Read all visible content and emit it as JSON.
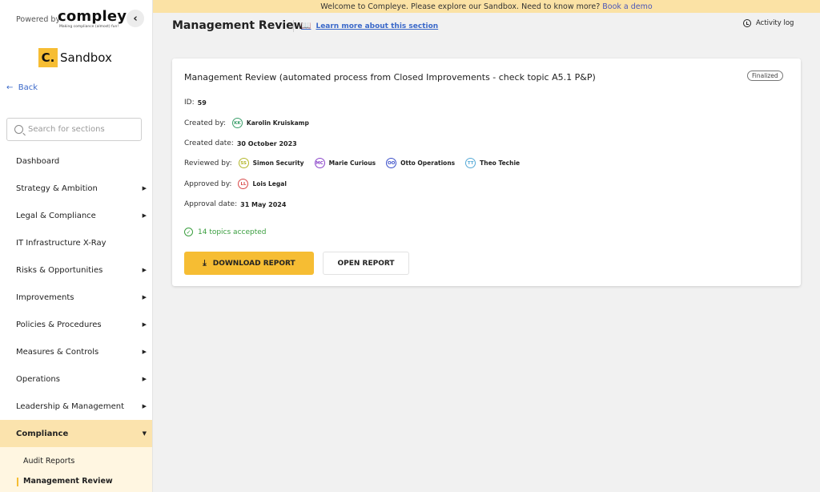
{
  "brand": {
    "powered_by": "Powered by",
    "logo": "compleye",
    "tagline": "Making compliance (almost) fun!",
    "org_initial": "C.",
    "org_name": "Sandbox",
    "collapse_icon": "chevron-left-icon"
  },
  "sidebar": {
    "back_label": "Back",
    "search_placeholder": "Search for sections",
    "items": [
      {
        "label": "Dashboard",
        "has_children": false
      },
      {
        "label": "Strategy & Ambition",
        "has_children": true
      },
      {
        "label": "Legal & Compliance",
        "has_children": true
      },
      {
        "label": "IT Infrastructure X-Ray",
        "has_children": false
      },
      {
        "label": "Risks & Opportunities",
        "has_children": true
      },
      {
        "label": "Improvements",
        "has_children": true
      },
      {
        "label": "Policies & Procedures",
        "has_children": true
      },
      {
        "label": "Measures & Controls",
        "has_children": true
      },
      {
        "label": "Operations",
        "has_children": true
      },
      {
        "label": "Leadership & Management",
        "has_children": true
      },
      {
        "label": "Compliance",
        "has_children": true,
        "expanded": true
      }
    ],
    "subitems": [
      {
        "label": "Audit Reports"
      },
      {
        "label": "Management Review",
        "current": true
      }
    ]
  },
  "banner": {
    "text": "Welcome to Compleye. Please explore our Sandbox. Need to know more?",
    "link": "Book a demo"
  },
  "header": {
    "title": "Management Review",
    "learn_more": "Learn more about this section",
    "activity_log": "Activity log"
  },
  "review": {
    "title": "Management Review (automated process from Closed Improvements - check topic A5.1 P&P)",
    "status": "Finalized",
    "id_label": "ID:",
    "id_value": "59",
    "created_by_label": "Created by:",
    "created_by": {
      "initials": "KK",
      "name": "Karolin Kruiskamp",
      "color": "#3a9e6a"
    },
    "created_date_label": "Created date:",
    "created_date": "30 October 2023",
    "reviewed_by_label": "Reviewed by:",
    "reviewers": [
      {
        "initials": "SS",
        "name": "Simon Security",
        "color": "#b3b62a"
      },
      {
        "initials": "MC",
        "name": "Marie Curious",
        "color": "#8a43c9"
      },
      {
        "initials": "OO",
        "name": "Otto Operations",
        "color": "#3b4fc9"
      },
      {
        "initials": "TT",
        "name": "Theo Techie",
        "color": "#55a9d6"
      }
    ],
    "approved_by_label": "Approved by:",
    "approver": {
      "initials": "LL",
      "name": "Lois Legal",
      "color": "#d94a4a"
    },
    "approval_date_label": "Approval date:",
    "approval_date": "31 May 2024",
    "topics_accepted": "14 topics accepted",
    "download_label": "DOWNLOAD REPORT",
    "open_label": "OPEN REPORT"
  },
  "colors": {
    "accent": "#f6bd33",
    "link": "#3a68c9",
    "success": "#3a9e3f"
  }
}
